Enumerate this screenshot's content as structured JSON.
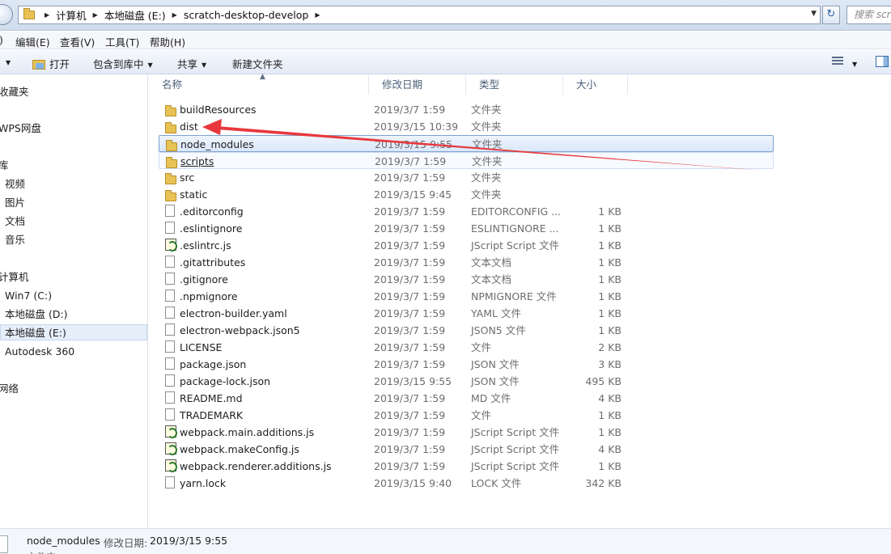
{
  "address": {
    "crumbs": [
      "计算机",
      "本地磁盘 (E:)",
      "scratch-desktop-develop"
    ],
    "search_placeholder": "搜索 scratch-desktop-develop"
  },
  "menu": [
    "编辑(E)",
    "查看(V)",
    "工具(T)",
    "帮助(H)"
  ],
  "toolbar": {
    "open": "打开",
    "include_library": "包含到库中",
    "share": "共享",
    "new_folder": "新建文件夹"
  },
  "nav": {
    "favorites": "收藏夹",
    "wps": "WPS网盘",
    "libraries": "库",
    "videos": "视频",
    "pictures": "图片",
    "documents": "文档",
    "music": "音乐",
    "computer": "计算机",
    "drive_c": "Win7 (C:)",
    "drive_d": "本地磁盘 (D:)",
    "drive_e": "本地磁盘 (E:)",
    "autodesk": "Autodesk 360",
    "network": "网络"
  },
  "columns": {
    "name": "名称",
    "date": "修改日期",
    "type": "类型",
    "size": "大小"
  },
  "files": [
    {
      "name": "buildResources",
      "date": "2019/3/7 1:59",
      "type": "文件夹",
      "size": "",
      "icon": "folder-icon"
    },
    {
      "name": "dist",
      "date": "2019/3/15 10:39",
      "type": "文件夹",
      "size": "",
      "icon": "folder-icon"
    },
    {
      "name": "node_modules",
      "date": "2019/3/15 9:55",
      "type": "文件夹",
      "size": "",
      "icon": "folder-icon",
      "state": "selected"
    },
    {
      "name": "scripts",
      "date": "2019/3/7 1:59",
      "type": "文件夹",
      "size": "",
      "icon": "folder-icon",
      "state": "hover"
    },
    {
      "name": "src",
      "date": "2019/3/7 1:59",
      "type": "文件夹",
      "size": "",
      "icon": "folder-icon"
    },
    {
      "name": "static",
      "date": "2019/3/15 9:45",
      "type": "文件夹",
      "size": "",
      "icon": "folder-icon"
    },
    {
      "name": ".editorconfig",
      "date": "2019/3/7 1:59",
      "type": "EDITORCONFIG ...",
      "size": "1 KB",
      "icon": "file-icon"
    },
    {
      "name": ".eslintignore",
      "date": "2019/3/7 1:59",
      "type": "ESLINTIGNORE ...",
      "size": "1 KB",
      "icon": "file-icon"
    },
    {
      "name": ".eslintrc.js",
      "date": "2019/3/7 1:59",
      "type": "JScript Script 文件",
      "size": "1 KB",
      "icon": "js-file-icon"
    },
    {
      "name": ".gitattributes",
      "date": "2019/3/7 1:59",
      "type": "文本文档",
      "size": "1 KB",
      "icon": "file-icon"
    },
    {
      "name": ".gitignore",
      "date": "2019/3/7 1:59",
      "type": "文本文档",
      "size": "1 KB",
      "icon": "file-icon"
    },
    {
      "name": ".npmignore",
      "date": "2019/3/7 1:59",
      "type": "NPMIGNORE 文件",
      "size": "1 KB",
      "icon": "file-icon"
    },
    {
      "name": "electron-builder.yaml",
      "date": "2019/3/7 1:59",
      "type": "YAML 文件",
      "size": "1 KB",
      "icon": "file-icon"
    },
    {
      "name": "electron-webpack.json5",
      "date": "2019/3/7 1:59",
      "type": "JSON5 文件",
      "size": "1 KB",
      "icon": "file-icon"
    },
    {
      "name": "LICENSE",
      "date": "2019/3/7 1:59",
      "type": "文件",
      "size": "2 KB",
      "icon": "file-icon"
    },
    {
      "name": "package.json",
      "date": "2019/3/7 1:59",
      "type": "JSON 文件",
      "size": "3 KB",
      "icon": "file-icon"
    },
    {
      "name": "package-lock.json",
      "date": "2019/3/15 9:55",
      "type": "JSON 文件",
      "size": "495 KB",
      "icon": "file-icon"
    },
    {
      "name": "README.md",
      "date": "2019/3/7 1:59",
      "type": "MD 文件",
      "size": "4 KB",
      "icon": "file-icon"
    },
    {
      "name": "TRADEMARK",
      "date": "2019/3/7 1:59",
      "type": "文件",
      "size": "1 KB",
      "icon": "file-icon"
    },
    {
      "name": "webpack.main.additions.js",
      "date": "2019/3/7 1:59",
      "type": "JScript Script 文件",
      "size": "1 KB",
      "icon": "js-file-icon"
    },
    {
      "name": "webpack.makeConfig.js",
      "date": "2019/3/7 1:59",
      "type": "JScript Script 文件",
      "size": "4 KB",
      "icon": "js-file-icon"
    },
    {
      "name": "webpack.renderer.additions.js",
      "date": "2019/3/7 1:59",
      "type": "JScript Script 文件",
      "size": "1 KB",
      "icon": "js-file-icon"
    },
    {
      "name": "yarn.lock",
      "date": "2019/3/15 9:40",
      "type": "LOCK 文件",
      "size": "342 KB",
      "icon": "file-icon"
    }
  ],
  "status": {
    "name": "node_modules",
    "date_label": "修改日期:",
    "date": "2019/3/15 9:55",
    "type": "文件夹"
  },
  "colors": {
    "annotation_arrow": "#e8383d",
    "selection_border": "#7da2ce"
  }
}
